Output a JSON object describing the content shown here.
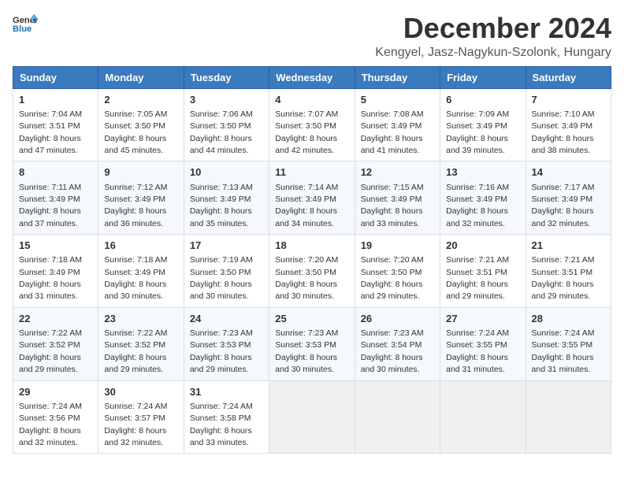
{
  "logo": {
    "general": "General",
    "blue": "Blue"
  },
  "title": "December 2024",
  "subtitle": "Kengyel, Jasz-Nagykun-Szolonk, Hungary",
  "headers": [
    "Sunday",
    "Monday",
    "Tuesday",
    "Wednesday",
    "Thursday",
    "Friday",
    "Saturday"
  ],
  "weeks": [
    [
      {
        "day": "1",
        "sunrise": "7:04 AM",
        "sunset": "3:51 PM",
        "daylight": "8 hours and 47 minutes."
      },
      {
        "day": "2",
        "sunrise": "7:05 AM",
        "sunset": "3:50 PM",
        "daylight": "8 hours and 45 minutes."
      },
      {
        "day": "3",
        "sunrise": "7:06 AM",
        "sunset": "3:50 PM",
        "daylight": "8 hours and 44 minutes."
      },
      {
        "day": "4",
        "sunrise": "7:07 AM",
        "sunset": "3:50 PM",
        "daylight": "8 hours and 42 minutes."
      },
      {
        "day": "5",
        "sunrise": "7:08 AM",
        "sunset": "3:49 PM",
        "daylight": "8 hours and 41 minutes."
      },
      {
        "day": "6",
        "sunrise": "7:09 AM",
        "sunset": "3:49 PM",
        "daylight": "8 hours and 39 minutes."
      },
      {
        "day": "7",
        "sunrise": "7:10 AM",
        "sunset": "3:49 PM",
        "daylight": "8 hours and 38 minutes."
      }
    ],
    [
      {
        "day": "8",
        "sunrise": "7:11 AM",
        "sunset": "3:49 PM",
        "daylight": "8 hours and 37 minutes."
      },
      {
        "day": "9",
        "sunrise": "7:12 AM",
        "sunset": "3:49 PM",
        "daylight": "8 hours and 36 minutes."
      },
      {
        "day": "10",
        "sunrise": "7:13 AM",
        "sunset": "3:49 PM",
        "daylight": "8 hours and 35 minutes."
      },
      {
        "day": "11",
        "sunrise": "7:14 AM",
        "sunset": "3:49 PM",
        "daylight": "8 hours and 34 minutes."
      },
      {
        "day": "12",
        "sunrise": "7:15 AM",
        "sunset": "3:49 PM",
        "daylight": "8 hours and 33 minutes."
      },
      {
        "day": "13",
        "sunrise": "7:16 AM",
        "sunset": "3:49 PM",
        "daylight": "8 hours and 32 minutes."
      },
      {
        "day": "14",
        "sunrise": "7:17 AM",
        "sunset": "3:49 PM",
        "daylight": "8 hours and 32 minutes."
      }
    ],
    [
      {
        "day": "15",
        "sunrise": "7:18 AM",
        "sunset": "3:49 PM",
        "daylight": "8 hours and 31 minutes."
      },
      {
        "day": "16",
        "sunrise": "7:18 AM",
        "sunset": "3:49 PM",
        "daylight": "8 hours and 30 minutes."
      },
      {
        "day": "17",
        "sunrise": "7:19 AM",
        "sunset": "3:50 PM",
        "daylight": "8 hours and 30 minutes."
      },
      {
        "day": "18",
        "sunrise": "7:20 AM",
        "sunset": "3:50 PM",
        "daylight": "8 hours and 30 minutes."
      },
      {
        "day": "19",
        "sunrise": "7:20 AM",
        "sunset": "3:50 PM",
        "daylight": "8 hours and 29 minutes."
      },
      {
        "day": "20",
        "sunrise": "7:21 AM",
        "sunset": "3:51 PM",
        "daylight": "8 hours and 29 minutes."
      },
      {
        "day": "21",
        "sunrise": "7:21 AM",
        "sunset": "3:51 PM",
        "daylight": "8 hours and 29 minutes."
      }
    ],
    [
      {
        "day": "22",
        "sunrise": "7:22 AM",
        "sunset": "3:52 PM",
        "daylight": "8 hours and 29 minutes."
      },
      {
        "day": "23",
        "sunrise": "7:22 AM",
        "sunset": "3:52 PM",
        "daylight": "8 hours and 29 minutes."
      },
      {
        "day": "24",
        "sunrise": "7:23 AM",
        "sunset": "3:53 PM",
        "daylight": "8 hours and 29 minutes."
      },
      {
        "day": "25",
        "sunrise": "7:23 AM",
        "sunset": "3:53 PM",
        "daylight": "8 hours and 30 minutes."
      },
      {
        "day": "26",
        "sunrise": "7:23 AM",
        "sunset": "3:54 PM",
        "daylight": "8 hours and 30 minutes."
      },
      {
        "day": "27",
        "sunrise": "7:24 AM",
        "sunset": "3:55 PM",
        "daylight": "8 hours and 31 minutes."
      },
      {
        "day": "28",
        "sunrise": "7:24 AM",
        "sunset": "3:55 PM",
        "daylight": "8 hours and 31 minutes."
      }
    ],
    [
      {
        "day": "29",
        "sunrise": "7:24 AM",
        "sunset": "3:56 PM",
        "daylight": "8 hours and 32 minutes."
      },
      {
        "day": "30",
        "sunrise": "7:24 AM",
        "sunset": "3:57 PM",
        "daylight": "8 hours and 32 minutes."
      },
      {
        "day": "31",
        "sunrise": "7:24 AM",
        "sunset": "3:58 PM",
        "daylight": "8 hours and 33 minutes."
      },
      null,
      null,
      null,
      null
    ]
  ],
  "labels": {
    "sunrise": "Sunrise:",
    "sunset": "Sunset:",
    "daylight": "Daylight:"
  }
}
